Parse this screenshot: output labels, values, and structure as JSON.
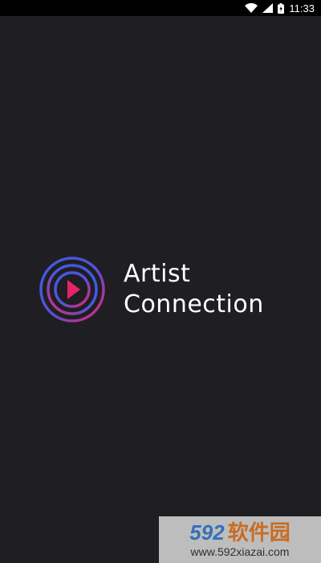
{
  "status_bar": {
    "time": "11:33",
    "icons": [
      "wifi-icon",
      "signal-icon",
      "battery-charging-icon"
    ]
  },
  "splash": {
    "line1": "Artist",
    "line2": "Connection",
    "logo_icon": "play-rings-logo-icon"
  },
  "watermark": {
    "number": "592",
    "chinese": "软件园",
    "url": "www.592xiazai.com"
  },
  "colors": {
    "background": "#1f1e22",
    "status_bar": "#000000",
    "ring_blue": "#3d5be0",
    "ring_pink": "#e6246a",
    "text": "#ffffff"
  }
}
